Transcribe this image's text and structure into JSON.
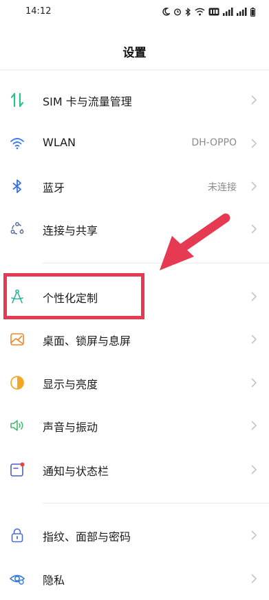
{
  "status_bar": {
    "time": "14:12"
  },
  "header": {
    "title": "设置"
  },
  "settings": [
    {
      "label": "SIM 卡与流量管理",
      "value": ""
    },
    {
      "label": "WLAN",
      "value": "DH-OPPO"
    },
    {
      "label": "蓝牙",
      "value": "未连接"
    },
    {
      "label": "连接与共享",
      "value": ""
    },
    {
      "label": "个性化定制",
      "value": ""
    },
    {
      "label": "桌面、锁屏与息屏",
      "value": ""
    },
    {
      "label": "显示与亮度",
      "value": ""
    },
    {
      "label": "声音与振动",
      "value": ""
    },
    {
      "label": "通知与状态栏",
      "value": ""
    },
    {
      "label": "指纹、面部与密码",
      "value": ""
    },
    {
      "label": "隐私",
      "value": ""
    }
  ],
  "colors": {
    "annotation": "#e53a52",
    "sim_icon": "#2bbf8a",
    "wifi_icon": "#3b7cf0",
    "bluetooth_icon": "#3b6fe0",
    "connection_icon": "#5a6d9a",
    "personalize_icon": "#28b39a",
    "wallpaper_icon": "#f0852a",
    "display_icon": "#f5a623",
    "sound_icon": "#3dbb6b",
    "notification_icon": "#4a5fbf",
    "security_icon": "#4a6bd6",
    "privacy_icon": "#3a7bd5"
  }
}
